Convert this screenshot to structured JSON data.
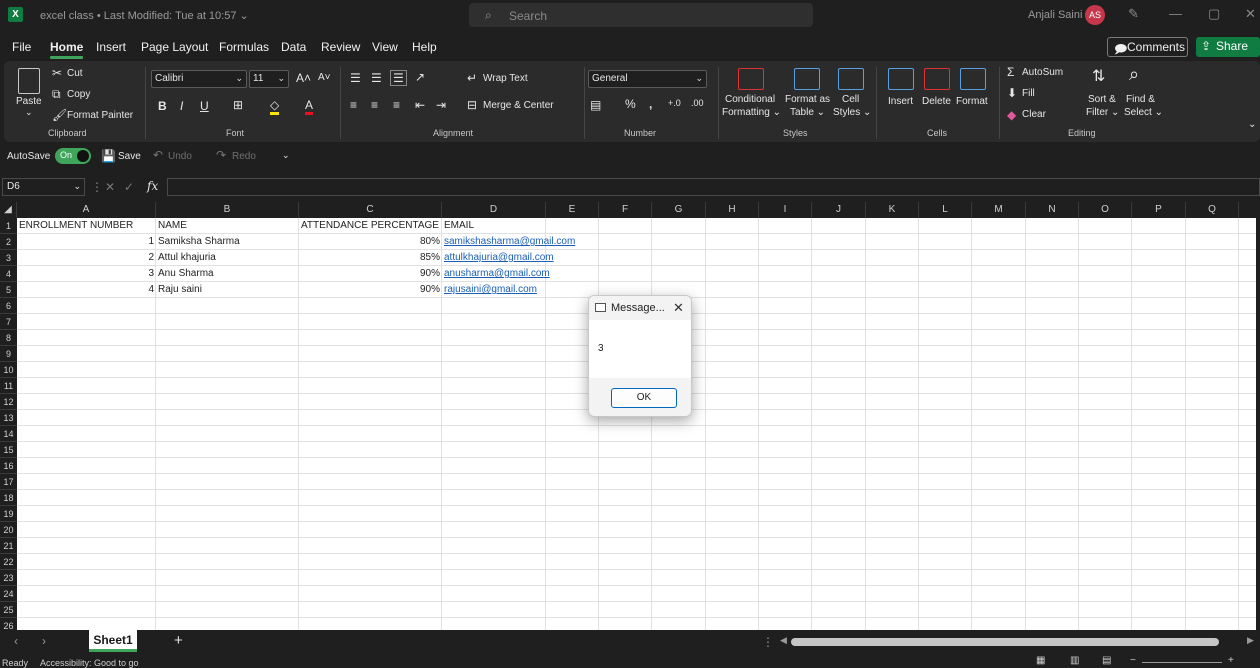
{
  "titlebar": {
    "doc_title": "excel class • Last Modified: Tue at 10:57 ⌄",
    "search_placeholder": "Search",
    "user_name": "Anjali Saini",
    "user_initials": "AS"
  },
  "menu": [
    "File",
    "Home",
    "Insert",
    "Page Layout",
    "Formulas",
    "Data",
    "Review",
    "View",
    "Help"
  ],
  "actions": {
    "comments": "Comments",
    "share": "Share"
  },
  "ribbon": {
    "clipboard": {
      "paste": "Paste",
      "cut": "Cut",
      "copy": "Copy",
      "format_painter": "Format Painter",
      "label": "Clipboard"
    },
    "font": {
      "name": "Calibri",
      "size": "11",
      "label": "Font"
    },
    "alignment": {
      "wrap": "Wrap Text",
      "merge": "Merge & Center",
      "label": "Alignment"
    },
    "number": {
      "format": "General",
      "label": "Number"
    },
    "styles": {
      "conditional_1": "Conditional",
      "conditional_2": "Formatting ⌄",
      "format_as_1": "Format as",
      "format_as_2": "Table ⌄",
      "cell_1": "Cell",
      "cell_2": "Styles ⌄",
      "label": "Styles"
    },
    "cells": {
      "insert": "Insert",
      "delete": "Delete",
      "format": "Format",
      "label": "Cells"
    },
    "editing": {
      "autosum": "AutoSum",
      "fill": "Fill",
      "clear": "Clear",
      "sort_1": "Sort &",
      "sort_2": "Filter ⌄",
      "find_1": "Find &",
      "find_2": "Select ⌄",
      "label": "Editing"
    }
  },
  "qat": {
    "autosave": "AutoSave",
    "toggle": "On",
    "save": "Save",
    "undo": "Undo",
    "redo": "Redo"
  },
  "formula_bar": {
    "name_box": "D6",
    "fx": "fx",
    "value": ""
  },
  "columns": [
    "A",
    "B",
    "C",
    "D",
    "E",
    "F",
    "G",
    "H",
    "I",
    "J",
    "K",
    "L",
    "M",
    "N",
    "O",
    "P",
    "Q"
  ],
  "rows": [
    "1",
    "2",
    "3",
    "4",
    "5",
    "6",
    "7",
    "8",
    "9",
    "10",
    "11",
    "12",
    "13",
    "14",
    "15",
    "16",
    "17",
    "18",
    "19",
    "20",
    "21",
    "22",
    "23",
    "24",
    "25",
    "26"
  ],
  "sheet": {
    "headers": [
      "ENROLLMENT NUMBER",
      "NAME",
      "ATTENDANCE PERCENTAGE",
      "EMAIL"
    ],
    "data": [
      {
        "no": "1",
        "name": "Samiksha Sharma",
        "pct": "80%",
        "email": "samikshasharma@gmail.com"
      },
      {
        "no": "2",
        "name": "Attul khajuria",
        "pct": "85%",
        "email": "attulkhajuria@gmail.com"
      },
      {
        "no": "3",
        "name": "Anu Sharma",
        "pct": "90%",
        "email": "anusharma@gmail.com"
      },
      {
        "no": "4",
        "name": "Raju saini",
        "pct": "90%",
        "email": "rajusaini@gmail.com"
      }
    ]
  },
  "dialog": {
    "title": "Message...",
    "message": "3",
    "ok": "OK"
  },
  "sheets": {
    "tab": "Sheet1",
    "add": "+"
  },
  "status": {
    "ready": "Ready",
    "accessibility": "Accessibility: Good to go"
  }
}
